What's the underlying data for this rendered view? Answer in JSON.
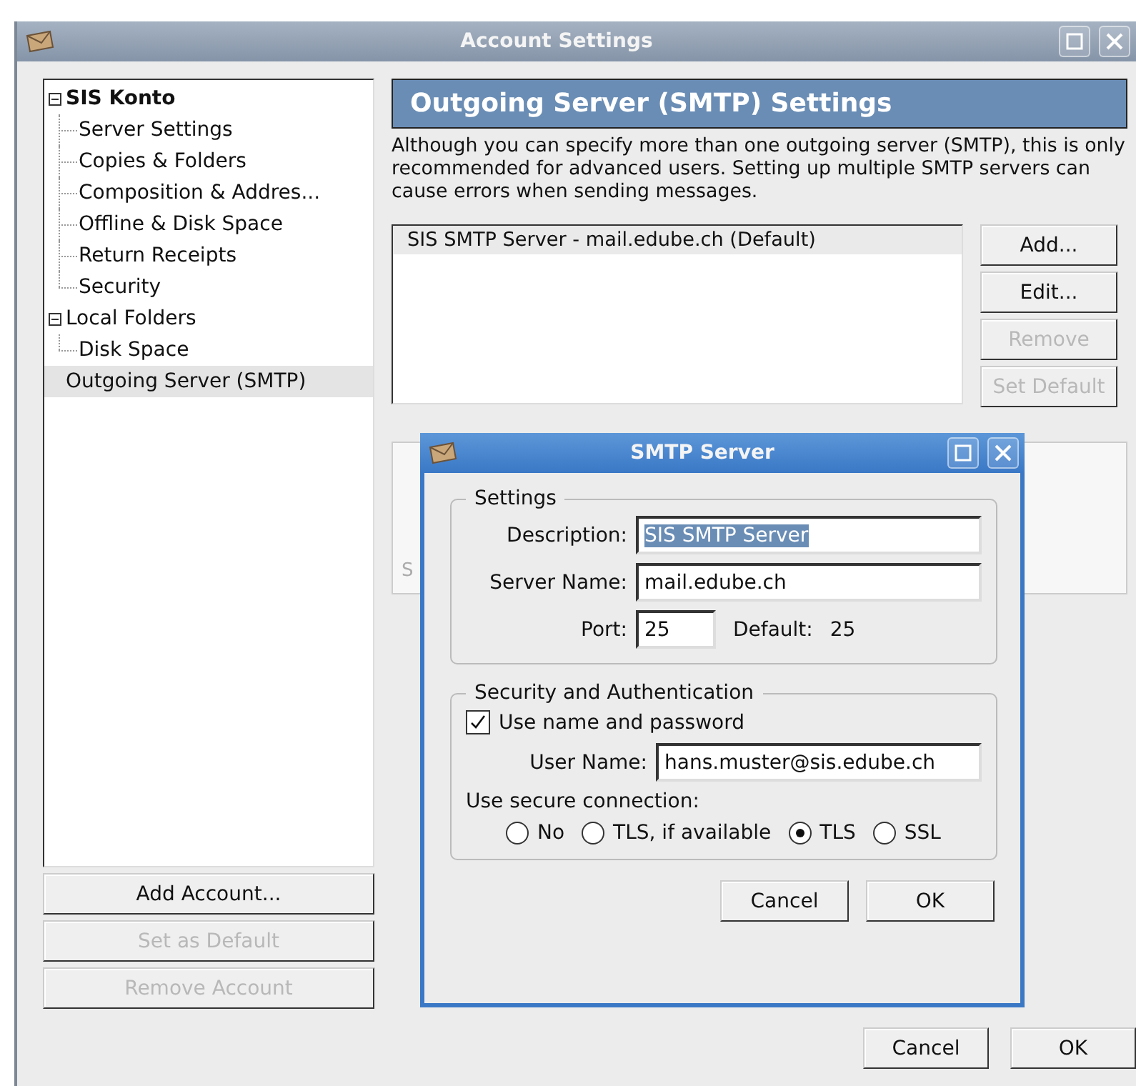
{
  "window": {
    "title": "Account Settings"
  },
  "sidebar": {
    "tree": [
      {
        "label": "SIS Konto",
        "bold": true,
        "expanded": true,
        "selected": false,
        "children": [
          {
            "label": "Server Settings",
            "selected": false
          },
          {
            "label": "Copies & Folders",
            "selected": false
          },
          {
            "label": "Composition & Addres...",
            "selected": false
          },
          {
            "label": "Offline & Disk Space",
            "selected": false
          },
          {
            "label": "Return Receipts",
            "selected": false
          },
          {
            "label": "Security",
            "selected": false
          }
        ]
      },
      {
        "label": "Local Folders",
        "bold": false,
        "expanded": true,
        "selected": false,
        "children": [
          {
            "label": "Disk Space",
            "selected": false
          }
        ]
      },
      {
        "label": "Outgoing Server (SMTP)",
        "bold": false,
        "selected": true
      }
    ],
    "buttons": [
      {
        "label": "Add Account...",
        "disabled": false
      },
      {
        "label": "Set as Default",
        "disabled": true
      },
      {
        "label": "Remove Account",
        "disabled": true
      }
    ]
  },
  "panel": {
    "header": "Outgoing Server (SMTP) Settings",
    "description": "Although you can specify more than one outgoing server (SMTP), this is only recommended for advanced users. Setting up multiple SMTP servers can cause errors when sending messages.",
    "servers": [
      {
        "label": "SIS SMTP Server - mail.edube.ch (Default)",
        "selected": true
      }
    ],
    "server_buttons": [
      {
        "label": "Add...",
        "disabled": false
      },
      {
        "label": "Edit...",
        "disabled": false
      },
      {
        "label": "Remove",
        "disabled": true
      },
      {
        "label": "Set Default",
        "disabled": true
      }
    ],
    "details_text": "S"
  },
  "footer_buttons": [
    "Cancel",
    "OK"
  ],
  "dialog": {
    "title": "SMTP Server",
    "settings": {
      "legend": "Settings",
      "description": {
        "label": "Description:",
        "value": "SIS SMTP Server",
        "text_selected": true
      },
      "server_name": {
        "label": "Server Name:",
        "value": "mail.edube.ch",
        "text_selected": false
      },
      "port": {
        "label": "Port:",
        "value": "25",
        "default_label": "Default:",
        "default_value": "25"
      }
    },
    "security": {
      "legend": "Security and Authentication",
      "use_password": {
        "label": "Use name and password",
        "checked": true
      },
      "user_name": {
        "label": "User Name:",
        "value": "hans.muster@sis.edube.ch"
      },
      "connection_label": "Use secure connection:",
      "options": [
        {
          "label": "No",
          "selected": false
        },
        {
          "label": "TLS, if available",
          "selected": false
        },
        {
          "label": "TLS",
          "selected": true
        },
        {
          "label": "SSL",
          "selected": false
        }
      ]
    },
    "buttons": [
      "Cancel",
      "OK"
    ]
  }
}
